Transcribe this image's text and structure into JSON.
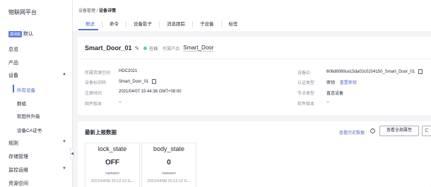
{
  "sidebar": {
    "brand": "物联网平台",
    "instance_tag": "基础版",
    "instance_label": "默认",
    "items": {
      "overview": "总览",
      "product": "产品",
      "device": "设备",
      "all_devices": "所有设备",
      "group": "群组",
      "firmware": "软固件升级",
      "ca_cert": "设备CA证书",
      "rules": "规则",
      "storage": "存储管理",
      "monitor": "监控运维",
      "resource_space": "资源空间"
    }
  },
  "breadcrumb": {
    "parent": "设备管理",
    "separator": " / ",
    "current": "设备详情"
  },
  "tabs": [
    "概述",
    "命令",
    "设备影子",
    "消息跟踪",
    "子设备",
    "标签"
  ],
  "device": {
    "name": "Smart_Door_01",
    "status": "在线",
    "product_label": "所属产品",
    "product_value": "Smart_Door"
  },
  "info": {
    "resource_space_label": "所属资源空间",
    "resource_space": "HDC2021",
    "device_id_label": "设备ID",
    "device_id": "606d6089ce15da02c0204150_Smart_Door_01",
    "node_id_label": "设备标识码",
    "node_id": "Smart_Door_01",
    "auth_type_label": "认证类型",
    "auth_type": "密钥",
    "reset_secret": "重置密钥",
    "reg_time_label": "注册时间",
    "reg_time": "2021/04/07 15:44:36 GMT+08:00",
    "node_type_label": "节点类型",
    "node_type": "直连设备",
    "firmware_label": "固件版本",
    "firmware": "--",
    "software_label": "软件版本",
    "software": "--"
  },
  "latest": {
    "title": "最新上报数据",
    "history_link": "查看历史数据",
    "view_all": "查看全部属性",
    "refresh": "C",
    "properties": [
      {
        "name": "lock_state",
        "value": "OFF",
        "service": "<sensor>",
        "time": "2021/04/08 20:12:12 G..."
      },
      {
        "name": "body_state",
        "value": "0",
        "service": "<sensor>",
        "time": "2021/04/08 20:12:12 G..."
      }
    ]
  },
  "colors": {
    "accent": "#526ecc",
    "online": "#50d4ab",
    "tag": "#5e7ce0"
  }
}
